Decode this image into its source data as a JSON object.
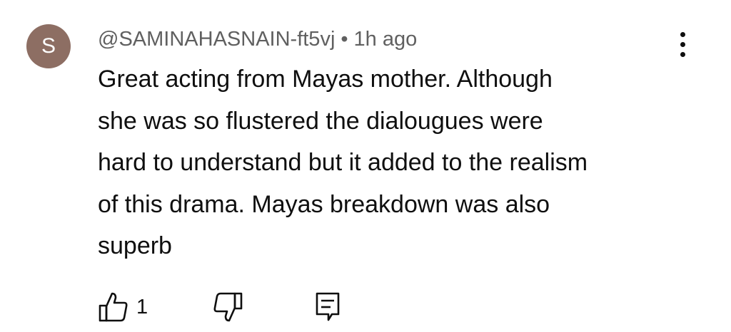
{
  "comment": {
    "avatar_initial": "S",
    "avatar_color": "#8d6e63",
    "author": "@SAMINAHASNAIN-ft5vj",
    "separator": "•",
    "timestamp": "1h ago",
    "text_lines": [
      "Great acting from Mayas mother. Although",
      "she was so flustered the dialougues were",
      "hard to understand but it added to the realism",
      "of this drama. Mayas breakdown was also",
      "superb"
    ],
    "like_count": "1"
  },
  "icons": {
    "menu": "more-vertical-icon",
    "like": "thumbs-up-icon",
    "dislike": "thumbs-down-icon",
    "reply": "reply-comment-icon"
  }
}
